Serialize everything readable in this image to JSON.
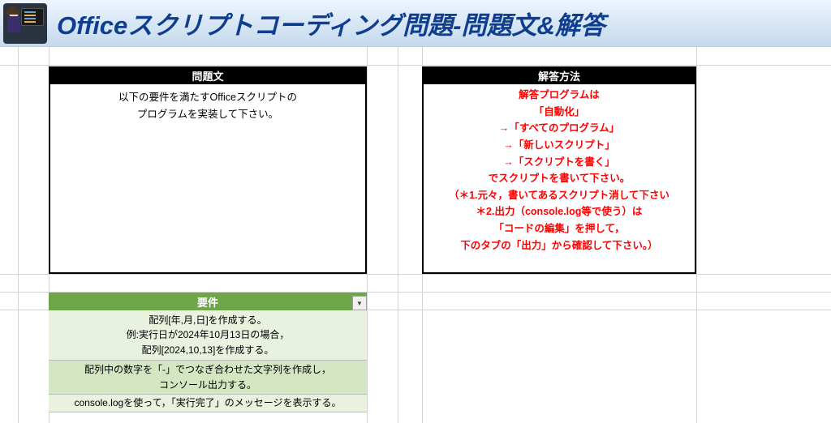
{
  "header": {
    "title": "Officeスクリプトコーディング問題-問題文&解答"
  },
  "problem": {
    "header": "問題文",
    "line1": "以下の要件を満たすOfficeスクリプトの",
    "line2": "プログラムを実装して下さい。"
  },
  "answer": {
    "header": "解答方法",
    "l1": "解答プログラムは",
    "l2": "「自動化」",
    "l3": "→「すべてのプログラム」",
    "l4": "→「新しいスクリプト」",
    "l5": "→「スクリプトを書く」",
    "l6": "でスクリプトを書いて下さい。",
    "l7": "（＊1.元々，書いてあるスクリプト消して下さい",
    "l8": "＊2.出力（console.log等で使う）は",
    "l9": "「コードの編集」を押して，",
    "l10": "下のタブの「出力」から確認して下さい。）"
  },
  "requirements": {
    "header": "要件",
    "r1a": "配列[年,月,日]を作成する。",
    "r1b": "例:実行日が2024年10月13日の場合，",
    "r1c": "配列[2024,10,13]を作成する。",
    "r2a": "配列中の数字を「-」でつなぎ合わせた文字列を作成し，",
    "r2b": "コンソール出力する。",
    "r3": "console.logを使って，「実行完了」のメッセージを表示する。"
  }
}
